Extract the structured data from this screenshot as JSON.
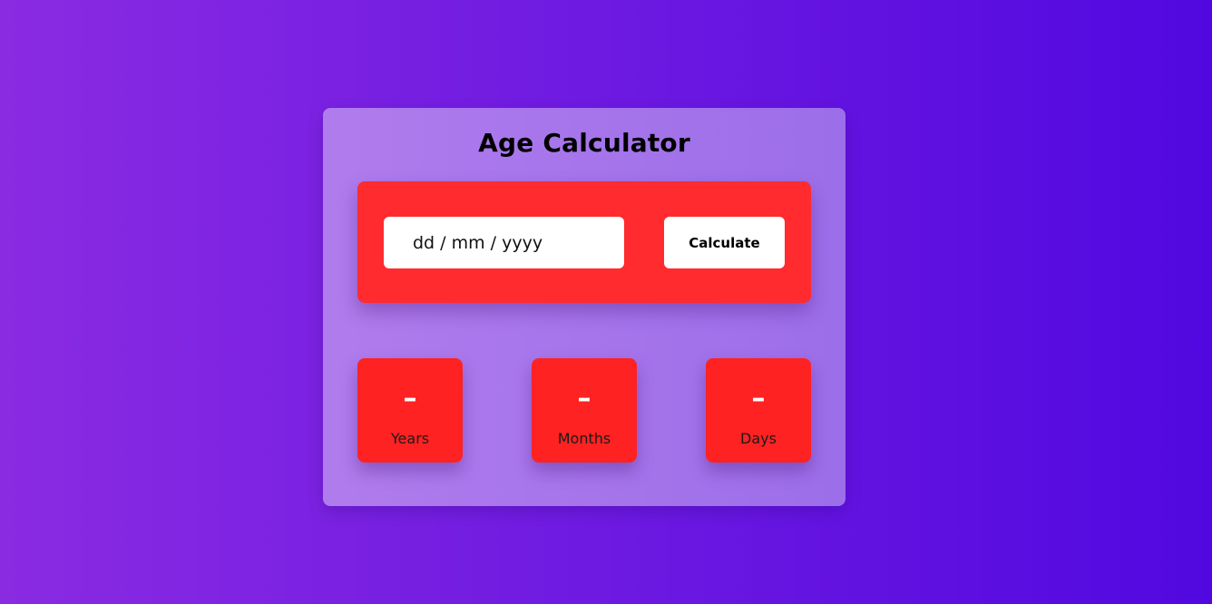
{
  "card": {
    "title": "Age Calculator"
  },
  "input": {
    "date_placeholder": "dd / mm / yyyy"
  },
  "button": {
    "calculate_label": "Calculate"
  },
  "results": {
    "years": {
      "value": "–",
      "label": "Years"
    },
    "months": {
      "value": "–",
      "label": "Months"
    },
    "days": {
      "value": "–",
      "label": "Days"
    }
  },
  "colors": {
    "background_start": "#8a2be2",
    "background_end": "#5108e0",
    "card": "#a876eb",
    "panel_red": "#ff2b2e",
    "result_red": "#ff2222",
    "button_white": "#ffffff"
  }
}
